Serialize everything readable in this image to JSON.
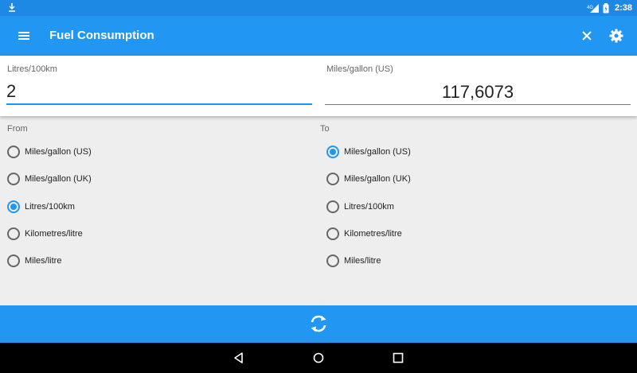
{
  "status_bar": {
    "time": "2:38",
    "network": "4G"
  },
  "app_bar": {
    "title": "Fuel Consumption"
  },
  "input": {
    "from_label": "Litres/100km",
    "from_value": "2",
    "to_label": "Miles/gallon (US)",
    "to_value": "117,6073"
  },
  "from": {
    "label": "From",
    "options": [
      "Miles/gallon (US)",
      "Miles/gallon (UK)",
      "Litres/100km",
      "Kilometres/litre",
      "Miles/litre"
    ],
    "selected": "Litres/100km"
  },
  "to": {
    "label": "To",
    "options": [
      "Miles/gallon (US)",
      "Miles/gallon (UK)",
      "Litres/100km",
      "Kilometres/litre",
      "Miles/litre"
    ],
    "selected": "Miles/gallon (US)"
  },
  "icons": {
    "status": [
      "download-icon",
      "signal-icon",
      "battery-icon"
    ],
    "app_bar": [
      "menu-icon",
      "close-icon",
      "gear-icon"
    ],
    "action": "refresh-icon",
    "nav": [
      "back-icon",
      "home-icon",
      "recents-icon"
    ]
  },
  "colors": {
    "primary": "#2196f3",
    "status_bar": "#1e88e5",
    "background": "#eeeeee"
  }
}
